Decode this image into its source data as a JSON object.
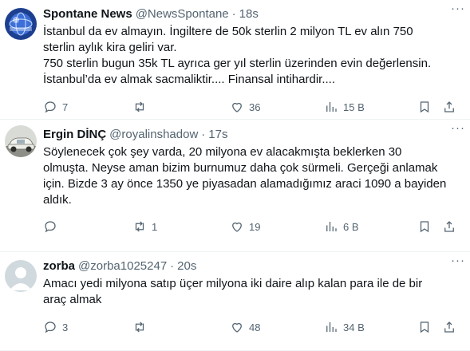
{
  "tweets": [
    {
      "name": "Spontane News",
      "handle": "@NewsSpontane",
      "time": "18s",
      "text": "İstanbul da ev almayın. İngiltere de 50k sterlin 2 milyon TL ev alın 750\nsterlin aylık kira geliri var.\n750 sterlin bugun 35k TL ayrıca ger yıl sterlin üzerinden evin değerlensin.\nİstanbul’da ev almak sacmaliktir.... Finansal intihardir....",
      "replies": "7",
      "retweets": "",
      "likes": "36",
      "views": "15 B"
    },
    {
      "name": "Ergin DİNÇ",
      "handle": "@royalinshadow",
      "time": "17s",
      "text": "Söylenecek çok şey varda, 20 milyona ev alacakmışta beklerken 30\nolmuşta. Neyse aman bizim burnumuz daha çok sürmeli. Gerçeği anlamak\niçin. Bizde 3 ay önce 1350 ye piyasadan alamadığımız araci 1090 a bayiden\naldık.",
      "replies": "",
      "retweets": "1",
      "likes": "19",
      "views": "6 B"
    },
    {
      "name": "zorba",
      "handle": "@zorba1025247",
      "time": "20s",
      "text": "Amacı yedi milyona satıp üçer milyona iki daire alıp kalan para ile de bir\naraç almak",
      "replies": "3",
      "retweets": "",
      "likes": "48",
      "views": "34 B"
    }
  ],
  "separator": "·",
  "more_label": "···",
  "colors": {
    "text": "#0f1419",
    "secondary": "#536471",
    "border": "#eff3f4"
  },
  "icons": [
    "reply-icon",
    "retweet-icon",
    "like-icon",
    "views-icon",
    "bookmark-icon",
    "share-icon",
    "more-icon"
  ]
}
